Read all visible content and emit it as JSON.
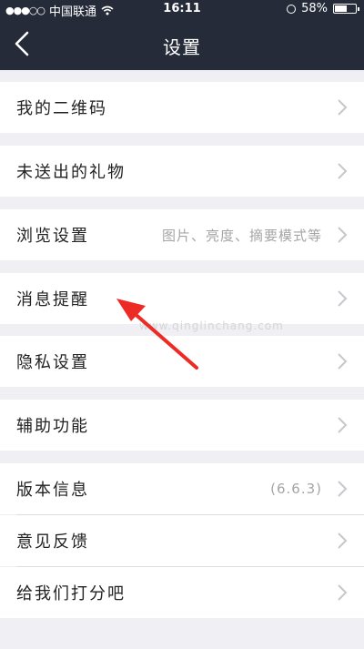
{
  "status_bar": {
    "carrier": "中国联通",
    "signal": "●●●○○",
    "time": "16:11",
    "battery": "58%",
    "battery_level": 0.58
  },
  "header": {
    "title": "设置",
    "back_icon": "chevron-left-icon"
  },
  "settings": {
    "qr_code": {
      "label": "我的二维码"
    },
    "gifts": {
      "label": "未送出的礼物"
    },
    "browse": {
      "label": "浏览设置",
      "hint": "图片、亮度、摘要模式等"
    },
    "notifications": {
      "label": "消息提醒"
    },
    "privacy": {
      "label": "隐私设置"
    },
    "accessibility": {
      "label": "辅助功能"
    },
    "version": {
      "label": "版本信息",
      "hint": "(6.6.3)"
    },
    "feedback": {
      "label": "意见反馈"
    },
    "rate": {
      "label": "给我们打分吧"
    }
  },
  "watermark": "www.qinglinchang.com",
  "colors": {
    "header_bg": "#252b38",
    "page_bg": "#efeff4",
    "row_bg": "#ffffff",
    "chevron": "#c7c7cc",
    "annotation_arrow": "#ee2a24"
  }
}
